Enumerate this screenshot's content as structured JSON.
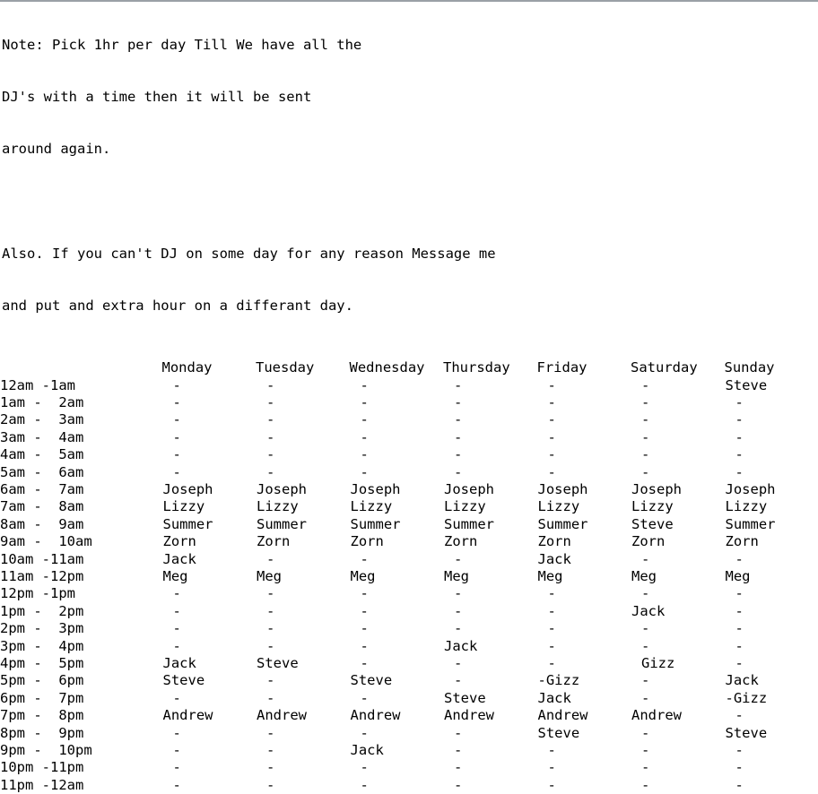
{
  "notes": {
    "line1": "Note: Pick 1hr per day Till We have all the",
    "line2": "DJ's with a time then it will be sent",
    "line3": "around again.",
    "line4": "Also. If you can't DJ on some day for any reason Message me",
    "line5": "and put and extra hour on a differant day."
  },
  "schedule": {
    "time_header": "",
    "days": [
      "Monday",
      "Tuesday",
      "Wednesday",
      "Thursday",
      "Friday",
      "Saturday",
      "Sunday"
    ],
    "rows": [
      {
        "time": "12am -1am",
        "slots": [
          "-",
          "-",
          "-",
          "-",
          "-",
          "-",
          "Steve"
        ]
      },
      {
        "time": "1am -  2am",
        "slots": [
          "-",
          "-",
          "-",
          "-",
          "-",
          "-",
          "-"
        ]
      },
      {
        "time": "2am -  3am",
        "slots": [
          "-",
          "-",
          "-",
          "-",
          "-",
          "-",
          "-"
        ]
      },
      {
        "time": "3am -  4am",
        "slots": [
          "-",
          "-",
          "-",
          "-",
          "-",
          "-",
          "-"
        ]
      },
      {
        "time": "4am -  5am",
        "slots": [
          "-",
          "-",
          "-",
          "-",
          "-",
          "-",
          "-"
        ]
      },
      {
        "time": "5am -  6am",
        "slots": [
          "-",
          "-",
          "-",
          "-",
          "-",
          "-",
          "-"
        ]
      },
      {
        "time": "6am -  7am",
        "slots": [
          "Joseph",
          "Joseph",
          "Joseph",
          "Joseph",
          "Joseph",
          "Joseph",
          "Joseph"
        ]
      },
      {
        "time": "7am -  8am",
        "slots": [
          "Lizzy",
          "Lizzy",
          "Lizzy",
          "Lizzy",
          "Lizzy",
          "Lizzy",
          "Lizzy"
        ]
      },
      {
        "time": "8am -  9am",
        "slots": [
          "Summer",
          "Summer",
          "Summer",
          "Summer",
          "Summer",
          "Steve",
          "Summer"
        ]
      },
      {
        "time": "9am -  10am",
        "slots": [
          "Zorn",
          "Zorn",
          "Zorn",
          "Zorn",
          "Zorn",
          "Zorn",
          "Zorn"
        ]
      },
      {
        "time": "10am -11am",
        "slots": [
          "Jack",
          "-",
          "-",
          "-",
          "Jack",
          "-",
          "-"
        ]
      },
      {
        "time": "11am -12pm",
        "slots": [
          "Meg",
          "Meg",
          "Meg",
          "Meg",
          "Meg",
          "Meg",
          "Meg"
        ]
      },
      {
        "time": "12pm -1pm",
        "slots": [
          "-",
          "-",
          "-",
          "-",
          "-",
          "-",
          "-"
        ]
      },
      {
        "time": "1pm -  2pm",
        "slots": [
          "-",
          "-",
          "-",
          "-",
          "-",
          "Jack",
          "-"
        ]
      },
      {
        "time": "2pm -  3pm",
        "slots": [
          "-",
          "-",
          "-",
          "-",
          "-",
          "-",
          "-"
        ]
      },
      {
        "time": "3pm -  4pm",
        "slots": [
          "-",
          "-",
          "-",
          "Jack",
          "-",
          "-",
          "-"
        ]
      },
      {
        "time": "4pm -  5pm",
        "slots": [
          "Jack",
          "Steve",
          "-",
          "-",
          "-",
          "Gizz",
          "-"
        ]
      },
      {
        "time": "5pm -  6pm",
        "slots": [
          "Steve",
          "-",
          "Steve",
          "-",
          "-Gizz",
          "-",
          "Jack"
        ]
      },
      {
        "time": "6pm -  7pm",
        "slots": [
          "-",
          "-",
          "-",
          "Steve",
          "Jack",
          "-",
          "-Gizz"
        ]
      },
      {
        "time": "7pm -  8pm",
        "slots": [
          "Andrew",
          "Andrew",
          "Andrew",
          "Andrew",
          "Andrew",
          "Andrew",
          "-"
        ]
      },
      {
        "time": "8pm -  9pm",
        "slots": [
          "-",
          "-",
          "-",
          "-",
          "Steve",
          "-",
          "Steve"
        ]
      },
      {
        "time": "9pm -  10pm",
        "slots": [
          "-",
          "-",
          "Jack",
          "-",
          "-",
          "-",
          "-"
        ]
      },
      {
        "time": "10pm -11pm",
        "slots": [
          "-",
          "-",
          "-",
          "-",
          "-",
          "-",
          "-"
        ]
      },
      {
        "time": "11pm -12am",
        "slots": [
          "-",
          "-",
          "-",
          "-",
          "-",
          "-",
          "-"
        ]
      }
    ]
  },
  "colors": {
    "text": "#000000",
    "background": "#ffffff",
    "top_rule": "#9aa0a6"
  }
}
